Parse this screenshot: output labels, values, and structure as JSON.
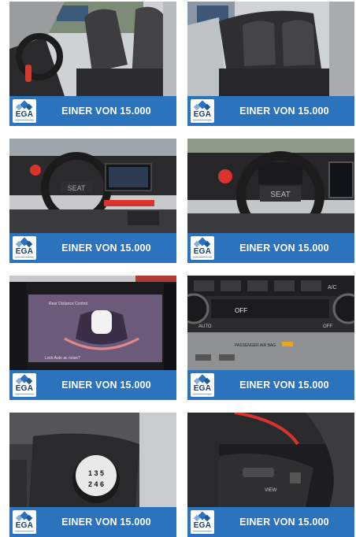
{
  "tiles": [
    {
      "logo": "EGA",
      "caption": "EINER VON 15.000"
    },
    {
      "logo": "EGA",
      "caption": "EINER VON 15.000"
    },
    {
      "logo": "EGA",
      "caption": "EINER VON 15.000"
    },
    {
      "logo": "EGA",
      "caption": "EINER VON 15.000"
    },
    {
      "logo": "EGA",
      "caption": "EINER VON 15.000"
    },
    {
      "logo": "EGA",
      "caption": "EINER VON 15.000"
    },
    {
      "logo": "EGA",
      "caption": "EINER VON 15.000"
    },
    {
      "logo": "EGA",
      "caption": "EINER VON 15.000"
    }
  ],
  "photos": {
    "infotainment_title": "Rear Distance Control",
    "infotainment_footer": "Lock Auto ac noise?",
    "climate_labels": [
      "OFF",
      "AUTO",
      "OFF",
      "A/C",
      "PASSENGER AIR BAG"
    ],
    "gear_pattern_top": "1 3 5",
    "gear_pattern_bottom": "2 4 6",
    "wheel_button": "VIEW"
  },
  "colors": {
    "banner": "#2b73bd",
    "accent_red": "#d9332b"
  }
}
